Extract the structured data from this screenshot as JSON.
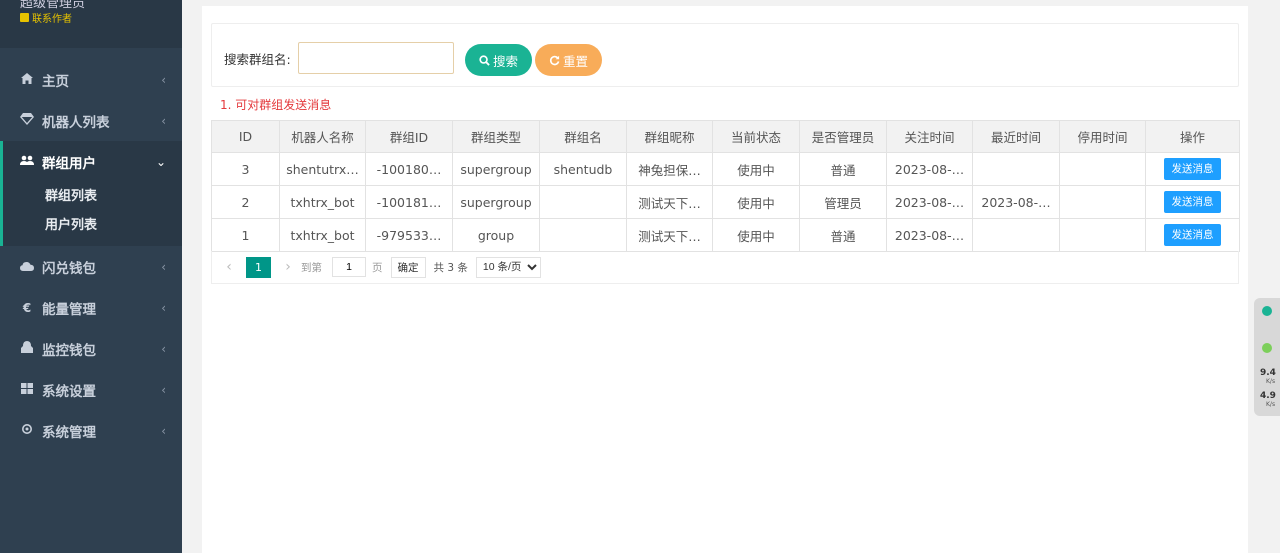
{
  "sidebar": {
    "username": "超级管理员",
    "contact": "联系作者",
    "items": [
      {
        "label": "主页",
        "icon": "home-icon"
      },
      {
        "label": "机器人列表",
        "icon": "diamond-icon"
      },
      {
        "label": "群组用户",
        "icon": "users-icon",
        "sub": [
          "群组列表",
          "用户列表"
        ]
      },
      {
        "label": "闪兑钱包",
        "icon": "cloud-icon"
      },
      {
        "label": "能量管理",
        "icon": "euro-icon"
      },
      {
        "label": "监控钱包",
        "icon": "eye-icon"
      },
      {
        "label": "系统设置",
        "icon": "grid-icon"
      },
      {
        "label": "系统管理",
        "icon": "gear-icon"
      }
    ]
  },
  "search": {
    "label": "搜索群组名:",
    "value": "",
    "search_btn": "搜索",
    "reset_btn": "重置"
  },
  "note": "1. 可对群组发送消息",
  "table": {
    "headers": [
      "ID",
      "机器人名称",
      "群组ID",
      "群组类型",
      "群组名",
      "群组昵称",
      "当前状态",
      "是否管理员",
      "关注时间",
      "最近时间",
      "停用时间",
      "操作"
    ],
    "rows": [
      [
        "3",
        "shentutrx…",
        "-100180…",
        "supergroup",
        "shentudb",
        "神兔担保…",
        "使用中",
        "普通",
        "2023-08-…",
        "",
        "",
        "发送消息"
      ],
      [
        "2",
        "txhtrx_bot",
        "-100181…",
        "supergroup",
        "",
        "测试天下…",
        "使用中",
        "管理员",
        "2023-08-…",
        "2023-08-…",
        "",
        "发送消息"
      ],
      [
        "1",
        "txhtrx_bot",
        "-979533…",
        "group",
        "",
        "测试天下…",
        "使用中",
        "普通",
        "2023-08-…",
        "",
        "",
        "发送消息"
      ]
    ]
  },
  "pager": {
    "current": "1",
    "goto_label": "到第",
    "page_input": "1",
    "page_unit": "页",
    "confirm": "确定",
    "total": "共 3 条",
    "size_option": "10 条/页"
  },
  "widget": {
    "up": "9.4",
    "down": "4.9",
    "unit": "K/s"
  },
  "colors": {
    "sidebar": "#2f4050",
    "accent": "#1ab394",
    "warning": "#f8ac59",
    "primary_btn": "#1e9fff",
    "note": "#e4393c"
  }
}
